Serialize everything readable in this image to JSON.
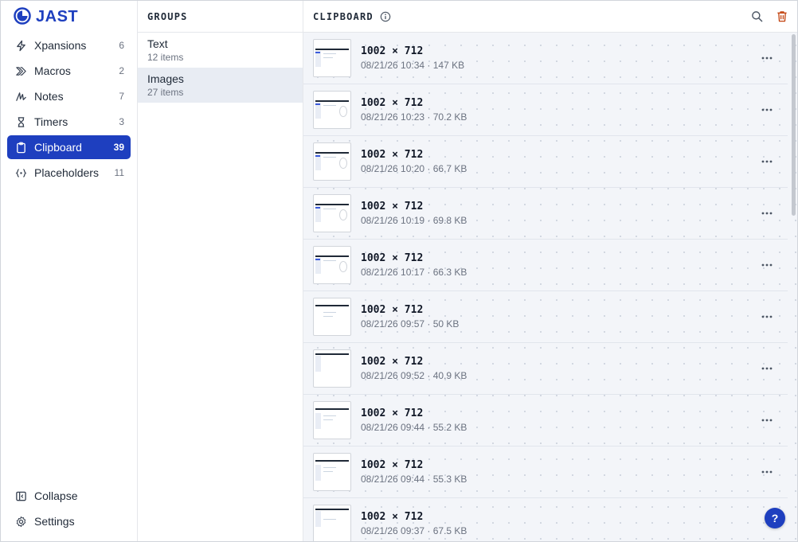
{
  "brand": {
    "name": "JAST",
    "color": "#1e3fbf"
  },
  "nav": {
    "items": [
      {
        "label": "Xpansions",
        "count": "6",
        "icon": "bolt-icon"
      },
      {
        "label": "Macros",
        "count": "2",
        "icon": "chevrons-right-icon"
      },
      {
        "label": "Notes",
        "count": "7",
        "icon": "scribble-icon"
      },
      {
        "label": "Timers",
        "count": "3",
        "icon": "hourglass-icon"
      },
      {
        "label": "Clipboard",
        "count": "39",
        "icon": "clipboard-icon",
        "active": true
      },
      {
        "label": "Placeholders",
        "count": "11",
        "icon": "braces-icon"
      }
    ],
    "bottom": [
      {
        "label": "Collapse",
        "icon": "sidebar-collapse-icon"
      },
      {
        "label": "Settings",
        "icon": "gear-icon"
      }
    ]
  },
  "groups": {
    "title": "GROUPS",
    "items": [
      {
        "name": "Text",
        "count": "12 items"
      },
      {
        "name": "Images",
        "count": "27 items",
        "active": true
      }
    ]
  },
  "clipboard": {
    "title": "CLIPBOARD",
    "items": [
      {
        "dims": "1002 × 712",
        "meta": "08/21/26 10:34 · 147 KB"
      },
      {
        "dims": "1002 × 712",
        "meta": "08/21/26 10:23 · 70.2 KB"
      },
      {
        "dims": "1002 × 712",
        "meta": "08/21/26 10:20 · 66.7 KB"
      },
      {
        "dims": "1002 × 712",
        "meta": "08/21/26 10:19 · 69.8 KB"
      },
      {
        "dims": "1002 × 712",
        "meta": "08/21/26 10:17 · 66.3 KB"
      },
      {
        "dims": "1002 × 712",
        "meta": "08/21/26 09:57 · 50 KB"
      },
      {
        "dims": "1002 × 712",
        "meta": "08/21/26 09:52 · 40.9 KB"
      },
      {
        "dims": "1002 × 712",
        "meta": "08/21/26 09:44 · 55.2 KB"
      },
      {
        "dims": "1002 × 712",
        "meta": "08/21/26 09:44 · 55.3 KB"
      },
      {
        "dims": "1002 × 712",
        "meta": "08/21/26 09:37 · 67.5 KB"
      }
    ]
  },
  "help": {
    "label": "?"
  },
  "colors": {
    "accent": "#1e3fbf",
    "delete": "#c2410c",
    "active_group_bg": "#e8ecf3",
    "list_bg": "#f3f5f9"
  }
}
